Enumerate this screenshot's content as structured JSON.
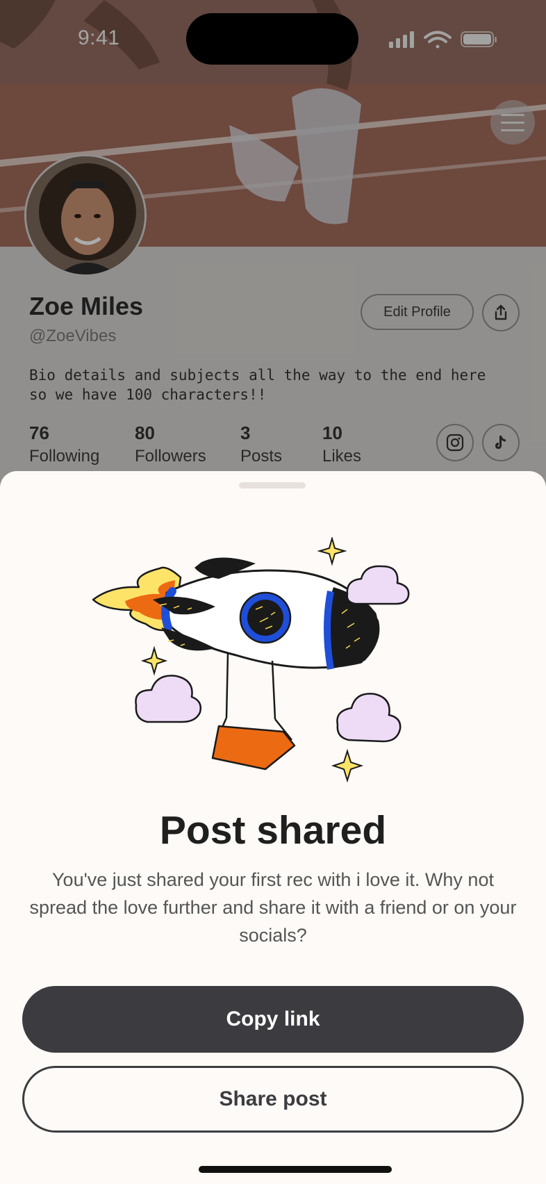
{
  "status_bar": {
    "time": "9:41"
  },
  "profile": {
    "name": "Zoe Miles",
    "handle": "@ZoeVibes",
    "edit_label": "Edit Profile",
    "bio": "Bio details and subjects all the way to the end here so we have 100 characters!!",
    "stats": [
      {
        "value": "76",
        "label": "Following"
      },
      {
        "value": "80",
        "label": "Followers"
      },
      {
        "value": "3",
        "label": "Posts"
      },
      {
        "value": "10",
        "label": "Likes"
      }
    ]
  },
  "sheet": {
    "title": "Post shared",
    "body": "You've just shared your first rec with i love it. Why not spread the love further and share it with a friend or on your socials?",
    "copy_label": "Copy link",
    "share_label": "Share post"
  },
  "icons": [
    "menu-icon",
    "share-icon",
    "instagram-icon",
    "tiktok-icon",
    "rocket-illustration"
  ],
  "colors": {
    "primary": "#3c3c40",
    "sheet_bg": "#fdfaf7",
    "accent_orange": "#ec6a12",
    "accent_blue": "#1f4fd8",
    "cloud_lilac": "#eedcf7"
  }
}
